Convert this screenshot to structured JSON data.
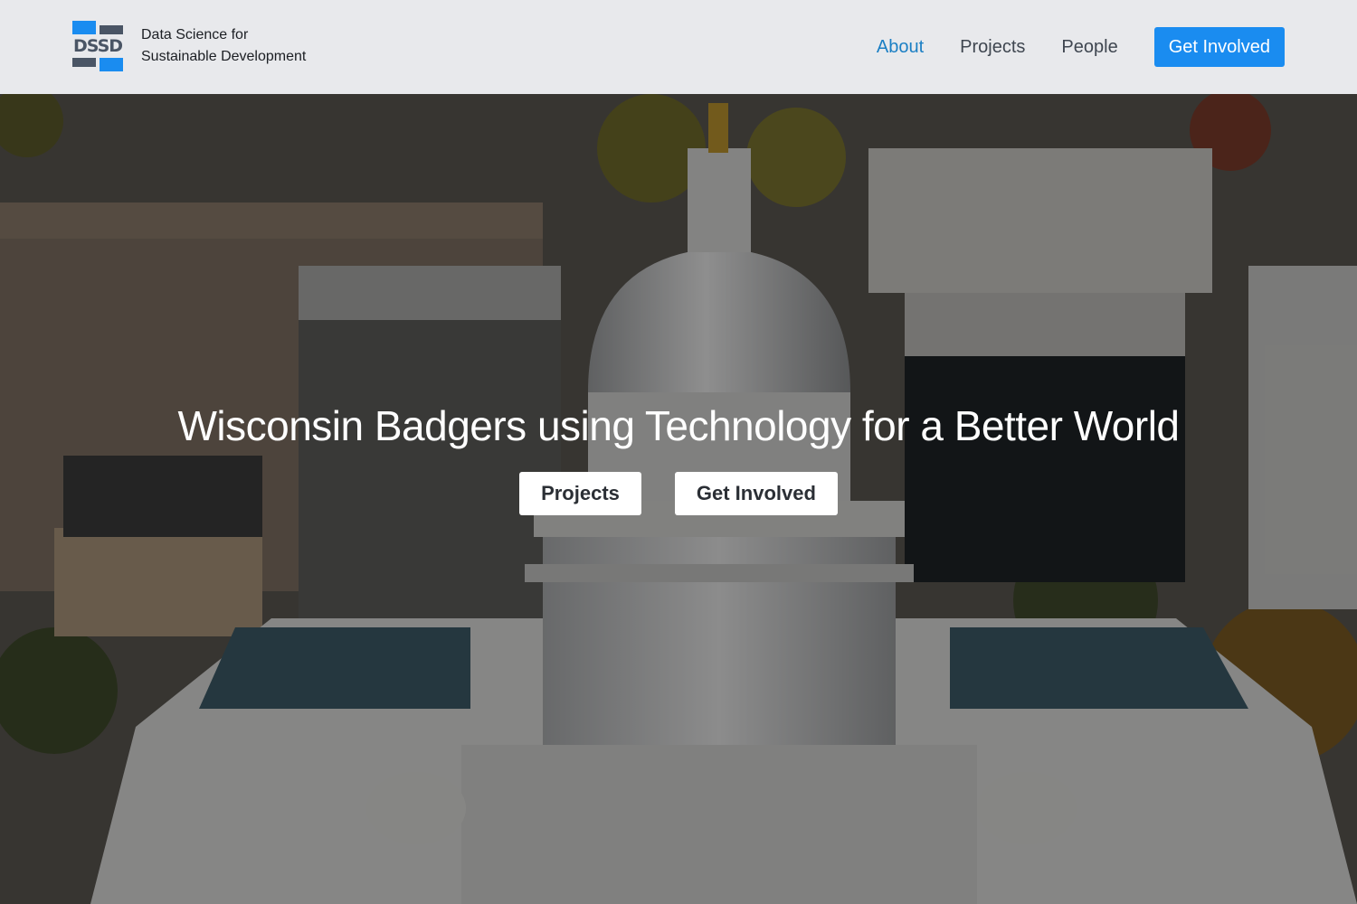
{
  "brand": {
    "logo_letters": "DSSD",
    "name_line1": "Data Science for",
    "name_line2": "Sustainable Development"
  },
  "nav": {
    "items": [
      {
        "label": "About",
        "active": true
      },
      {
        "label": "Projects",
        "active": false
      },
      {
        "label": "People",
        "active": false
      }
    ],
    "cta_label": "Get Involved"
  },
  "hero": {
    "title": "Wisconsin Badgers using Technology for a Better World",
    "buttons": [
      {
        "label": "Projects"
      },
      {
        "label": "Get Involved"
      }
    ],
    "background_image": "aerial-capitol-dome-photo"
  },
  "colors": {
    "accent": "#1a8cf0",
    "nav_active": "#1b7fc4",
    "header_bg": "#e8e9ec",
    "logo_gray": "#4a5565"
  }
}
